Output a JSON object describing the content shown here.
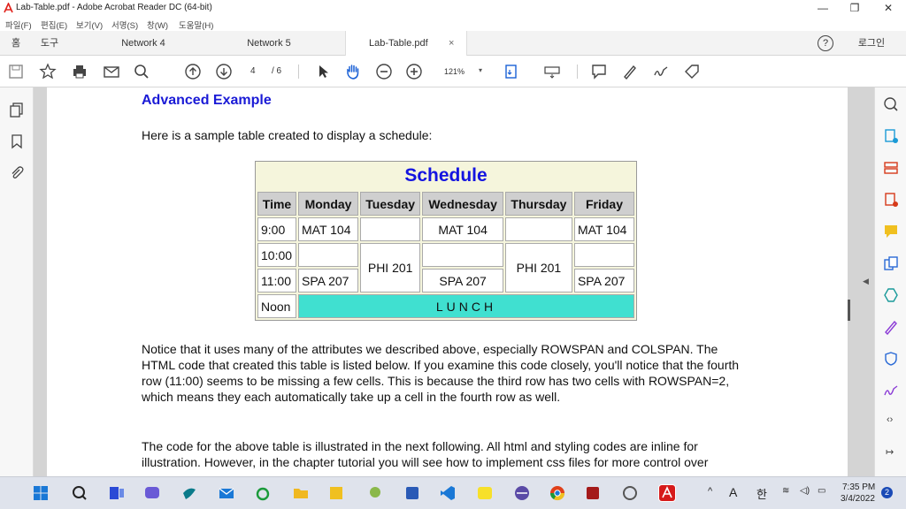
{
  "window": {
    "title": "Lab-Table.pdf - Adobe Acrobat Reader DC (64-bit)",
    "min": "—",
    "max": "❐",
    "close": "✕"
  },
  "menu": [
    "파일(F)",
    "편집(E)",
    "보기(V)",
    "서명(S)",
    "창(W)",
    "도움말(H)"
  ],
  "tabs": {
    "home": "홈",
    "tools": "도구",
    "items": [
      {
        "label": "Network 4"
      },
      {
        "label": "Network 5"
      },
      {
        "label": "Lab-Table.pdf",
        "close": "×"
      }
    ],
    "help": "?",
    "signin": "로그인"
  },
  "toolbar": {
    "page_current": "4",
    "page_total": "/ 6",
    "zoom": "121%"
  },
  "document": {
    "heading": "Advanced Example",
    "intro": "Here is a sample table created to display a schedule:",
    "table": {
      "caption": "Schedule",
      "headers": [
        "Time",
        "Monday",
        "Tuesday",
        "Wednesday",
        "Thursday",
        "Friday"
      ],
      "r1": {
        "time": "9:00",
        "mon": "MAT 104",
        "wed": "MAT 104",
        "fri": "MAT 104"
      },
      "r2": {
        "time": "10:00",
        "tue": "PHI 201",
        "thu": "PHI 201"
      },
      "r3": {
        "time": "11:00",
        "mon": "SPA 207",
        "wed": "SPA 207",
        "fri": "SPA 207"
      },
      "r4": {
        "time": "Noon",
        "lunch": "LUNCH"
      }
    },
    "para2": "Notice that it uses many of the attributes we described above, especially ROWSPAN and COLSPAN. The HTML code that created this table is listed below. If you examine this code closely, you'll notice that the fourth row (11:00) seems to be missing a few cells. This is because the third row has two cells with ROWSPAN=2, which means they each automatically take up a cell in the fourth row as well.",
    "para3": "The code for the above table is illustrated in the next following. All html and styling codes are inline for illustration. However, in the chapter tutorial you will see how to implement css files for more control over"
  },
  "taskbar": {
    "time": "7:35 PM",
    "date": "3/4/2022",
    "lang": "A",
    "ime": "한",
    "badge": "2"
  },
  "colors": {
    "heading": "#1a1ad6",
    "caption": "#1414e0",
    "lunch": "#40e0d0",
    "header_cell": "#cfcfcf",
    "table_bg": "#f5f5dc"
  }
}
